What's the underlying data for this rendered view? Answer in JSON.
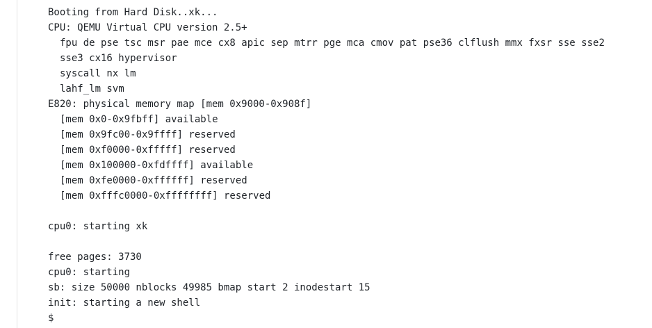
{
  "console": {
    "lines": [
      "Booting from Hard Disk..xk...",
      "CPU: QEMU Virtual CPU version 2.5+",
      "fpu de pse tsc msr pae mce cx8 apic sep mtrr pge mca cmov pat pse36 clflush mmx fxsr sse sse2",
      "sse3 cx16 hypervisor",
      "syscall nx lm",
      "lahf_lm svm",
      "E820: physical memory map [mem 0x9000-0x908f]",
      "[mem 0x0-0x9fbff] available",
      "[mem 0x9fc00-0x9ffff] reserved",
      "[mem 0xf0000-0xfffff] reserved",
      "[mem 0x100000-0xfdffff] available",
      "[mem 0xfe0000-0xffffff] reserved",
      "[mem 0xfffc0000-0xffffffff] reserved",
      "cpu0: starting xk",
      "free pages: 3730",
      "cpu0: starting",
      "sb: size 50000 nblocks 49985 bmap start 2 inodestart 15",
      "init: starting a new shell",
      "$"
    ]
  }
}
